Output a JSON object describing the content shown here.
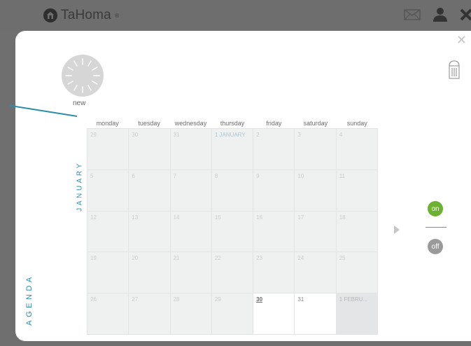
{
  "brand": {
    "name": "TaHoma",
    "registered": "®"
  },
  "header_icons": [
    "mail-icon",
    "user-icon",
    "close-icon"
  ],
  "dialog": {
    "close_symbol": "✕"
  },
  "new_program": {
    "label": "new"
  },
  "trash": {
    "icon": "trash-icon"
  },
  "calendar": {
    "month": "JANUARY",
    "weekdays": [
      "monday",
      "tuesday",
      "wednesday",
      "thursday",
      "friday",
      "saturday",
      "sunday"
    ],
    "weeks": [
      [
        {
          "label": "29",
          "state": "past"
        },
        {
          "label": "30",
          "state": "past"
        },
        {
          "label": "31",
          "state": "past"
        },
        {
          "label": "1 JANUARY",
          "state": "today"
        },
        {
          "label": "2",
          "state": "past"
        },
        {
          "label": "3",
          "state": "past"
        },
        {
          "label": "4",
          "state": "past"
        }
      ],
      [
        {
          "label": "5",
          "state": "past"
        },
        {
          "label": "6",
          "state": "past"
        },
        {
          "label": "7",
          "state": "past"
        },
        {
          "label": "8",
          "state": "past"
        },
        {
          "label": "9",
          "state": "past"
        },
        {
          "label": "10",
          "state": "past"
        },
        {
          "label": "11",
          "state": "past"
        }
      ],
      [
        {
          "label": "12",
          "state": "past"
        },
        {
          "label": "13",
          "state": "past"
        },
        {
          "label": "14",
          "state": "past"
        },
        {
          "label": "15",
          "state": "past"
        },
        {
          "label": "16",
          "state": "past"
        },
        {
          "label": "17",
          "state": "past"
        },
        {
          "label": "18",
          "state": "past"
        }
      ],
      [
        {
          "label": "19",
          "state": "past"
        },
        {
          "label": "20",
          "state": "past"
        },
        {
          "label": "21",
          "state": "past"
        },
        {
          "label": "22",
          "state": "past"
        },
        {
          "label": "23",
          "state": "past"
        },
        {
          "label": "24",
          "state": "past"
        },
        {
          "label": "25",
          "state": "past"
        }
      ],
      [
        {
          "label": "26",
          "state": "past"
        },
        {
          "label": "27",
          "state": "past"
        },
        {
          "label": "28",
          "state": "past"
        },
        {
          "label": "29",
          "state": "past"
        },
        {
          "label": "30",
          "state": "current"
        },
        {
          "label": "31",
          "state": "future"
        },
        {
          "label": "1 FEBRU...",
          "state": "next"
        }
      ]
    ]
  },
  "agenda": {
    "label": "AGENDA"
  },
  "toggles": {
    "on": "on",
    "off": "off"
  },
  "colors": {
    "accent": "#2c8ea8",
    "on": "#6cb230",
    "off": "#9a9a9a"
  }
}
